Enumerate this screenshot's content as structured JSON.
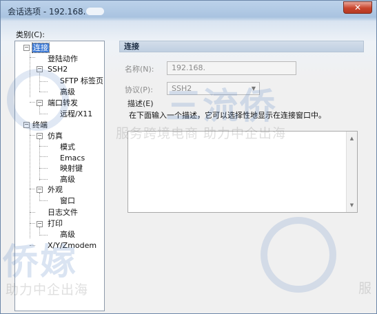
{
  "window": {
    "title": "会话选项 - 192.168.",
    "close_glyph": "✕"
  },
  "category_label": "类别(C):",
  "tree": [
    {
      "label": "连接",
      "toggle": "−"
    },
    {
      "label": "登陆动作"
    },
    {
      "label": "SSH2",
      "toggle": "−"
    },
    {
      "label": "SFTP 标签页"
    },
    {
      "label": "高级"
    },
    {
      "label": "端口转发",
      "toggle": "−"
    },
    {
      "label": "远程/X11"
    },
    {
      "label": "终端",
      "toggle": "−"
    },
    {
      "label": "仿真",
      "toggle": "−"
    },
    {
      "label": "模式"
    },
    {
      "label": "Emacs"
    },
    {
      "label": "映射键"
    },
    {
      "label": "高级"
    },
    {
      "label": "外观",
      "toggle": "−"
    },
    {
      "label": "窗口"
    },
    {
      "label": "日志文件"
    },
    {
      "label": "打印",
      "toggle": "−"
    },
    {
      "label": "高级"
    },
    {
      "label": "X/Y/Zmodem"
    }
  ],
  "panel": {
    "header": "连接",
    "name_label": "名称(N):",
    "name_value": "192.168.",
    "protocol_label": "协议(P):",
    "protocol_value": "SSH2",
    "description_label": "描述(E)",
    "description_hint": "在下面输入一个描述，它可以选择性地显示在连接窗口中。"
  },
  "watermark": {
    "logo_text": "三流侨",
    "sub_text": "服务跨境电商 助力中企出海",
    "logo_text_2": "侨嫁",
    "sub_text_2": "助力中企出海",
    "corner_text": "服"
  }
}
